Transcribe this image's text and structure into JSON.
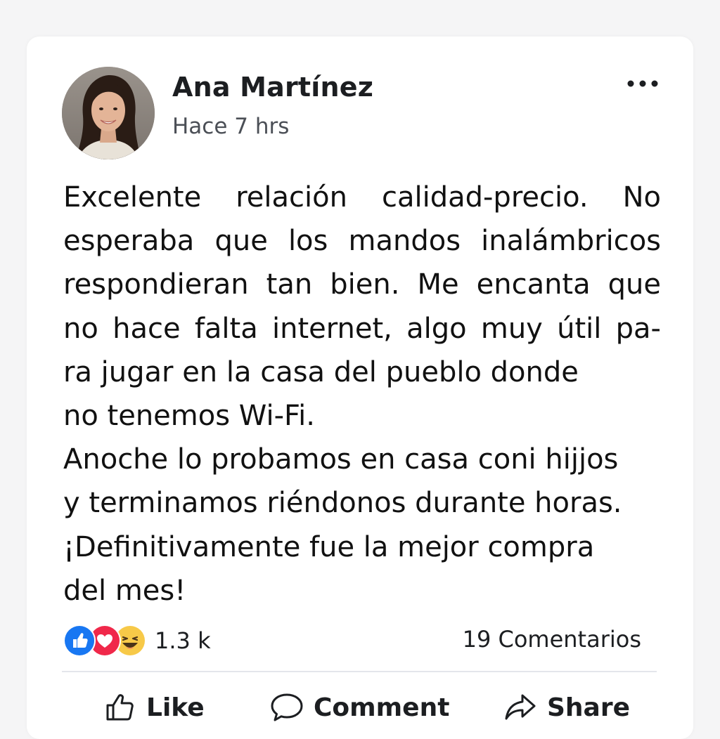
{
  "post": {
    "author": "Ana Martínez",
    "timestamp": "Hace 7 hrs",
    "menu_icon": "more-options-icon",
    "avatar": "profile-photo",
    "body_lines": [
      "Excelente relación calidad-precio. No",
      "esperaba que los mandos inalámbricos",
      "respondieran tan bien. Me encanta que",
      "no hace falta internet, algo muy útil pa-",
      "ra jugar en la casa del pueblo donde",
      "no tenemos Wi-Fi.",
      "Anoche lo probamos en casa coni hijjos",
      "y terminamos riéndonos durante horas.",
      "¡Definitivamente fue la mejor compra",
      "del mes!"
    ]
  },
  "stats": {
    "reaction_icons": [
      "like-reaction-icon",
      "love-reaction-icon",
      "haha-reaction-icon"
    ],
    "reactions_count": "1.3 k",
    "comments_count": "19 Comentarios"
  },
  "actions": {
    "like": {
      "label": "Like",
      "icon": "thumbs-up-icon"
    },
    "comment": {
      "label": "Comment",
      "icon": "speech-bubble-icon"
    },
    "share": {
      "label": "Share",
      "icon": "share-arrow-icon"
    }
  },
  "colors": {
    "like_blue": "#1877f2",
    "love_red": "#f0284a",
    "haha_yellow": "#f7c948",
    "text": "#1c1e21",
    "secondary_text": "#4b4f56"
  }
}
